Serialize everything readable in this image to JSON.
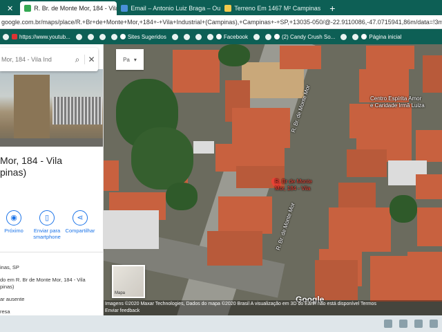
{
  "browser": {
    "tabs": [
      {
        "label": "R. Br. de Monte Mor, 184 - Vila In",
        "active": true,
        "icon": "maps-icon"
      },
      {
        "label": "Email – Antonio Luiz Braga – Ou",
        "active": false,
        "icon": "mail-icon"
      },
      {
        "label": "Terreno Em 1467 M² Campinas",
        "active": false,
        "icon": "site-icon"
      }
    ],
    "close_first": "✕",
    "new_tab": "+",
    "address": "google.com.br/maps/place/R.+Br+de+Monte+Mor,+184+-+Vila+Industrial+(Campinas),+Campinas+-+SP,+13035-050/@-22.9110086,-47.0715941,86m/data=!3m1!1e",
    "bookmarks": [
      {
        "label": "https://www.youtub...",
        "icon": "youtube-icon"
      },
      {
        "label": "Sites Sugeridos",
        "icon": "site-icon"
      },
      {
        "label": "Facebook",
        "icon": "facebook-icon"
      },
      {
        "label": "(2) Candy Crush So...",
        "icon": "game-icon"
      },
      {
        "label": "Página inicial",
        "icon": "home-icon"
      }
    ]
  },
  "panel": {
    "search_text": "Mor, 184 - Vila Ind",
    "title_line1": "Mor, 184 - Vila",
    "title_line2": "pinas)",
    "actions": [
      {
        "label": "Próximo",
        "icon": "nearby-icon"
      },
      {
        "label": "Enviar para smartphone",
        "icon": "phone-icon"
      },
      {
        "label": "Compartilhar",
        "icon": "share-icon"
      }
    ],
    "info": [
      "inas, SP",
      "do em R. Br de Monte Mor, 184 - Vila",
      "pinas)",
      "ar ausente",
      "resa"
    ]
  },
  "map": {
    "layer_label": "Pa",
    "pin_label_line1": "R. Br de Monte",
    "pin_label_line2": "Mor, 184 - Vila",
    "street_label": "R. Br. de Monte Mor",
    "poi_label_line1": "Centro Espírita Amor",
    "poi_label_line2": "e Caridade Irmã Luiza",
    "minimap_label": "Mapa",
    "google_logo": "Google",
    "footer_line1": "Imagens ©2020 Maxar Technologies, Dados do mapa ©2020    Brasil    A visualização em 3D do Earth não está disponível    Termos",
    "footer_line2": "Enviar feedback"
  }
}
